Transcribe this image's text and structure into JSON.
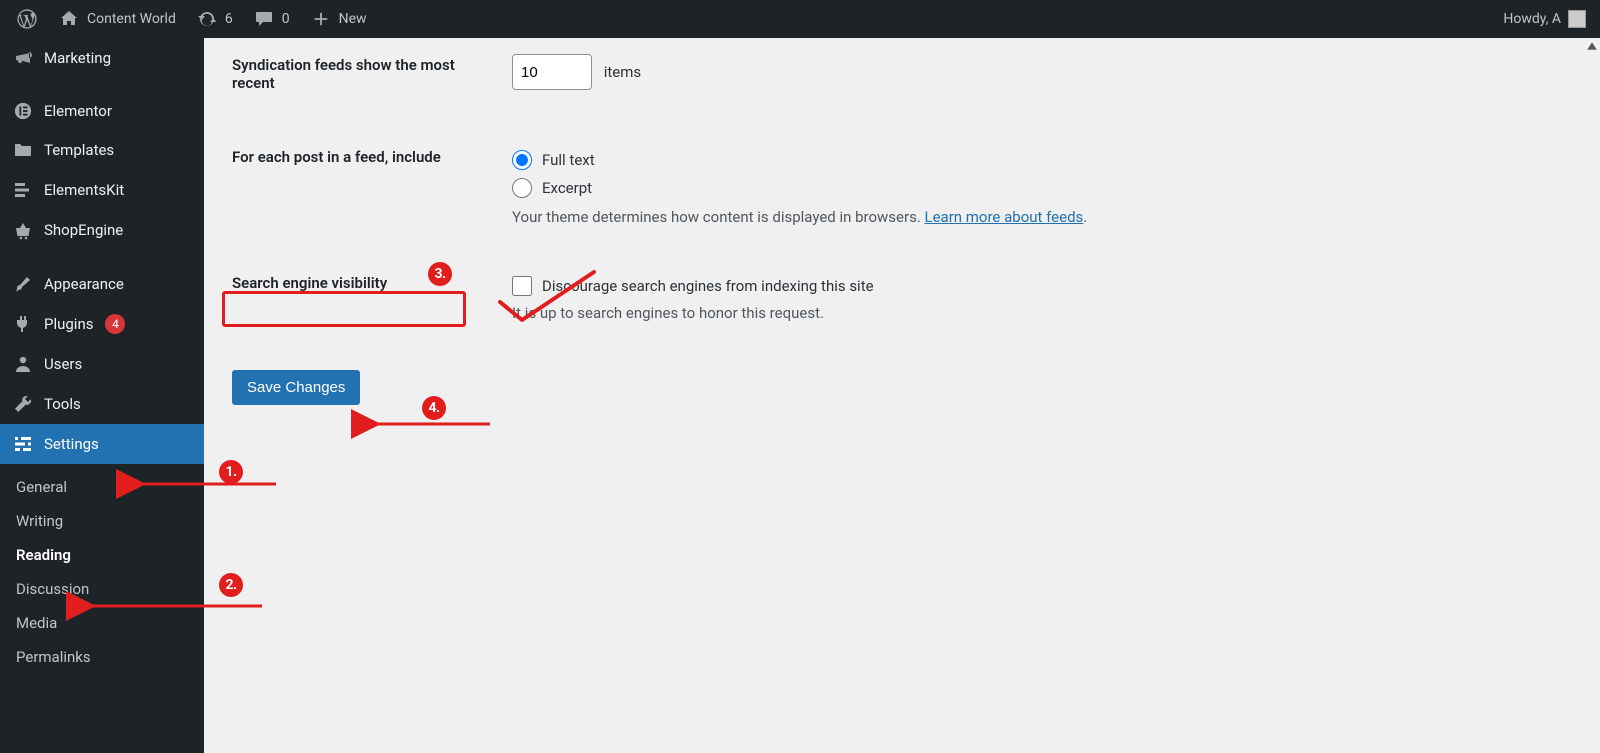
{
  "adminbar": {
    "site_name": "Content World",
    "updates_count": "6",
    "comments_count": "0",
    "new_label": "New",
    "howdy": "Howdy, A"
  },
  "sidebar": {
    "items": [
      {
        "icon": "megaphone",
        "label": "Marketing"
      },
      {
        "icon": "elementor",
        "label": "Elementor"
      },
      {
        "icon": "templates",
        "label": "Templates"
      },
      {
        "icon": "elementskit",
        "label": "ElementsKit"
      },
      {
        "icon": "shopengine",
        "label": "ShopEngine"
      },
      {
        "icon": "appearance",
        "label": "Appearance"
      },
      {
        "icon": "plugins",
        "label": "Plugins",
        "badge": "4"
      },
      {
        "icon": "users",
        "label": "Users"
      },
      {
        "icon": "tools",
        "label": "Tools"
      },
      {
        "icon": "settings",
        "label": "Settings",
        "current": true
      }
    ],
    "submenu": {
      "general": "General",
      "writing": "Writing",
      "reading": "Reading",
      "discussion": "Discussion",
      "media": "Media",
      "permalinks": "Permalinks"
    }
  },
  "main": {
    "syndication_label": "Syndication feeds show the most recent",
    "syndication_value": "10",
    "syndication_unit": "items",
    "feed_include_label": "For each post in a feed, include",
    "feed_full": "Full text",
    "feed_excerpt": "Excerpt",
    "feed_note_left": "Your theme determines how content is displayed in browsers. ",
    "feed_note_link": "Learn more about feeds",
    "sev_label": "Search engine visibility",
    "sev_check": "Discourage search engines from indexing this site",
    "sev_note": "It is up to search engines to honor this request.",
    "save": "Save Changes"
  },
  "annotations": {
    "n1": "1.",
    "n2": "2.",
    "n3": "3.",
    "n4": "4."
  }
}
